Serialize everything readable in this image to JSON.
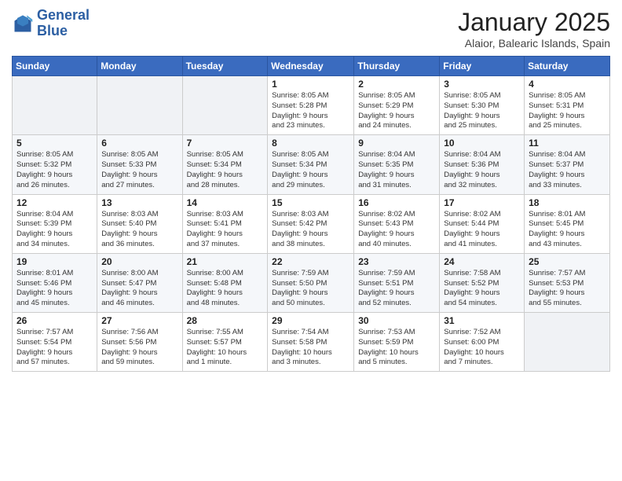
{
  "header": {
    "logo_line1": "General",
    "logo_line2": "Blue",
    "month_title": "January 2025",
    "location": "Alaior, Balearic Islands, Spain"
  },
  "weekdays": [
    "Sunday",
    "Monday",
    "Tuesday",
    "Wednesday",
    "Thursday",
    "Friday",
    "Saturday"
  ],
  "weeks": [
    [
      {
        "day": "",
        "info": ""
      },
      {
        "day": "",
        "info": ""
      },
      {
        "day": "",
        "info": ""
      },
      {
        "day": "1",
        "info": "Sunrise: 8:05 AM\nSunset: 5:28 PM\nDaylight: 9 hours\nand 23 minutes."
      },
      {
        "day": "2",
        "info": "Sunrise: 8:05 AM\nSunset: 5:29 PM\nDaylight: 9 hours\nand 24 minutes."
      },
      {
        "day": "3",
        "info": "Sunrise: 8:05 AM\nSunset: 5:30 PM\nDaylight: 9 hours\nand 25 minutes."
      },
      {
        "day": "4",
        "info": "Sunrise: 8:05 AM\nSunset: 5:31 PM\nDaylight: 9 hours\nand 25 minutes."
      }
    ],
    [
      {
        "day": "5",
        "info": "Sunrise: 8:05 AM\nSunset: 5:32 PM\nDaylight: 9 hours\nand 26 minutes."
      },
      {
        "day": "6",
        "info": "Sunrise: 8:05 AM\nSunset: 5:33 PM\nDaylight: 9 hours\nand 27 minutes."
      },
      {
        "day": "7",
        "info": "Sunrise: 8:05 AM\nSunset: 5:34 PM\nDaylight: 9 hours\nand 28 minutes."
      },
      {
        "day": "8",
        "info": "Sunrise: 8:05 AM\nSunset: 5:34 PM\nDaylight: 9 hours\nand 29 minutes."
      },
      {
        "day": "9",
        "info": "Sunrise: 8:04 AM\nSunset: 5:35 PM\nDaylight: 9 hours\nand 31 minutes."
      },
      {
        "day": "10",
        "info": "Sunrise: 8:04 AM\nSunset: 5:36 PM\nDaylight: 9 hours\nand 32 minutes."
      },
      {
        "day": "11",
        "info": "Sunrise: 8:04 AM\nSunset: 5:37 PM\nDaylight: 9 hours\nand 33 minutes."
      }
    ],
    [
      {
        "day": "12",
        "info": "Sunrise: 8:04 AM\nSunset: 5:39 PM\nDaylight: 9 hours\nand 34 minutes."
      },
      {
        "day": "13",
        "info": "Sunrise: 8:03 AM\nSunset: 5:40 PM\nDaylight: 9 hours\nand 36 minutes."
      },
      {
        "day": "14",
        "info": "Sunrise: 8:03 AM\nSunset: 5:41 PM\nDaylight: 9 hours\nand 37 minutes."
      },
      {
        "day": "15",
        "info": "Sunrise: 8:03 AM\nSunset: 5:42 PM\nDaylight: 9 hours\nand 38 minutes."
      },
      {
        "day": "16",
        "info": "Sunrise: 8:02 AM\nSunset: 5:43 PM\nDaylight: 9 hours\nand 40 minutes."
      },
      {
        "day": "17",
        "info": "Sunrise: 8:02 AM\nSunset: 5:44 PM\nDaylight: 9 hours\nand 41 minutes."
      },
      {
        "day": "18",
        "info": "Sunrise: 8:01 AM\nSunset: 5:45 PM\nDaylight: 9 hours\nand 43 minutes."
      }
    ],
    [
      {
        "day": "19",
        "info": "Sunrise: 8:01 AM\nSunset: 5:46 PM\nDaylight: 9 hours\nand 45 minutes."
      },
      {
        "day": "20",
        "info": "Sunrise: 8:00 AM\nSunset: 5:47 PM\nDaylight: 9 hours\nand 46 minutes."
      },
      {
        "day": "21",
        "info": "Sunrise: 8:00 AM\nSunset: 5:48 PM\nDaylight: 9 hours\nand 48 minutes."
      },
      {
        "day": "22",
        "info": "Sunrise: 7:59 AM\nSunset: 5:50 PM\nDaylight: 9 hours\nand 50 minutes."
      },
      {
        "day": "23",
        "info": "Sunrise: 7:59 AM\nSunset: 5:51 PM\nDaylight: 9 hours\nand 52 minutes."
      },
      {
        "day": "24",
        "info": "Sunrise: 7:58 AM\nSunset: 5:52 PM\nDaylight: 9 hours\nand 54 minutes."
      },
      {
        "day": "25",
        "info": "Sunrise: 7:57 AM\nSunset: 5:53 PM\nDaylight: 9 hours\nand 55 minutes."
      }
    ],
    [
      {
        "day": "26",
        "info": "Sunrise: 7:57 AM\nSunset: 5:54 PM\nDaylight: 9 hours\nand 57 minutes."
      },
      {
        "day": "27",
        "info": "Sunrise: 7:56 AM\nSunset: 5:56 PM\nDaylight: 9 hours\nand 59 minutes."
      },
      {
        "day": "28",
        "info": "Sunrise: 7:55 AM\nSunset: 5:57 PM\nDaylight: 10 hours\nand 1 minute."
      },
      {
        "day": "29",
        "info": "Sunrise: 7:54 AM\nSunset: 5:58 PM\nDaylight: 10 hours\nand 3 minutes."
      },
      {
        "day": "30",
        "info": "Sunrise: 7:53 AM\nSunset: 5:59 PM\nDaylight: 10 hours\nand 5 minutes."
      },
      {
        "day": "31",
        "info": "Sunrise: 7:52 AM\nSunset: 6:00 PM\nDaylight: 10 hours\nand 7 minutes."
      },
      {
        "day": "",
        "info": ""
      }
    ]
  ]
}
